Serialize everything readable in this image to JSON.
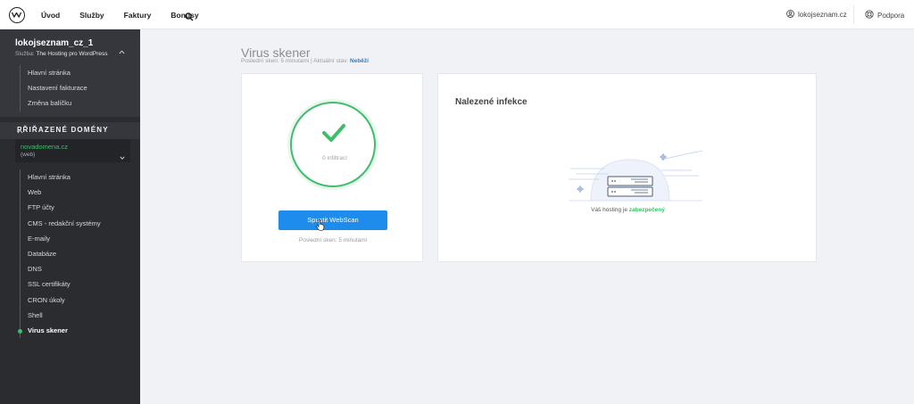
{
  "topbar": {
    "nav": [
      "Úvod",
      "Služby",
      "Faktury",
      "Bonusy"
    ],
    "account": "lokojseznam.cz",
    "support": "Podpora"
  },
  "sidebar": {
    "account_name": "lokojseznam_cz_1",
    "service_prefix": "Služba:",
    "service_name": "The Hosting pro WordPress",
    "account_items": [
      "Hlavní stránka",
      "Nastavení fakturace",
      "Změna balíčku"
    ],
    "domains_heading": "PŘIŘAZENÉ DOMÉNY",
    "domain_name": "novadomena.cz",
    "domain_type": "(web)",
    "domain_items": [
      "Hlavní stránka",
      "Web",
      "FTP účty",
      "CMS - redakční systémy",
      "E-maily",
      "Databáze",
      "DNS",
      "SSL certifikáty",
      "CRON úkoly",
      "Shell",
      "Virus skener"
    ]
  },
  "main": {
    "title": "Virus skener",
    "subtitle_prefix": "Poslední sken: 5 minutami | Aktuální stav:",
    "status": "Neběží",
    "scan": {
      "infiltrations": "0 infiltrací",
      "button": "Spustit WebScan",
      "last_scan": "Poslední sken: 5 minutami"
    },
    "infections": {
      "title": "Nalezené infekce",
      "secure_prefix": "Váš hosting je",
      "secure_status": "zabezpečený"
    }
  },
  "colors": {
    "accent_green": "#3fbd6a",
    "button_blue": "#1d8cec",
    "sidebar_bg": "#2b2c30"
  }
}
